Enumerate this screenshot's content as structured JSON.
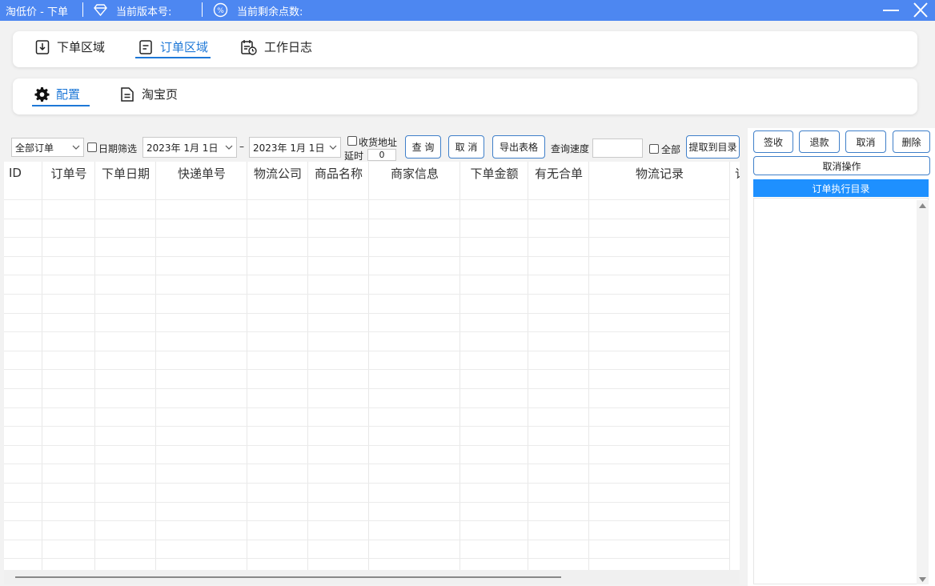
{
  "window": {
    "title": "淘低价 - 下单",
    "version_label": "当前版本号:",
    "points_label": "当前剩余点数:",
    "accent_color": "#4d87f1"
  },
  "main_tabs": [
    {
      "label": "下单区域",
      "icon": "download-box-icon",
      "active": false
    },
    {
      "label": "订单区域",
      "icon": "document-icon",
      "active": true
    },
    {
      "label": "工作日志",
      "icon": "calendar-clock-icon",
      "active": false
    }
  ],
  "sub_tabs": [
    {
      "label": "配置",
      "icon": "gear-icon",
      "active": true
    },
    {
      "label": "淘宝页",
      "icon": "page-icon",
      "active": false
    }
  ],
  "toolbar": {
    "order_filter": "全部订单",
    "date_filter_label": "日期筛选",
    "date_from": "2023年  1月  1日",
    "date_sep": "–",
    "date_to": "2023年  1月  1日",
    "address_label": "收货地址",
    "delay_label": "延时",
    "delay_value": "0",
    "query_button": "查 询",
    "cancel_button": "取 消",
    "export_button": "导出表格",
    "speed_label": "查询速度",
    "speed_value": "",
    "all_label": "全部",
    "extract_button": "提取到目录"
  },
  "table": {
    "columns": [
      "ID",
      "订单号",
      "下单日期",
      "快递单号",
      "物流公司",
      "商品名称",
      "商家信息",
      "下单金额",
      "有无合单",
      "物流记录",
      "订"
    ],
    "rows": []
  },
  "side": {
    "sign_button": "签收",
    "refund_button": "退款",
    "cancel_button": "取消",
    "delete_button": "删除",
    "cancel_op_button": "取消操作",
    "dir_header": "订单执行目录"
  }
}
